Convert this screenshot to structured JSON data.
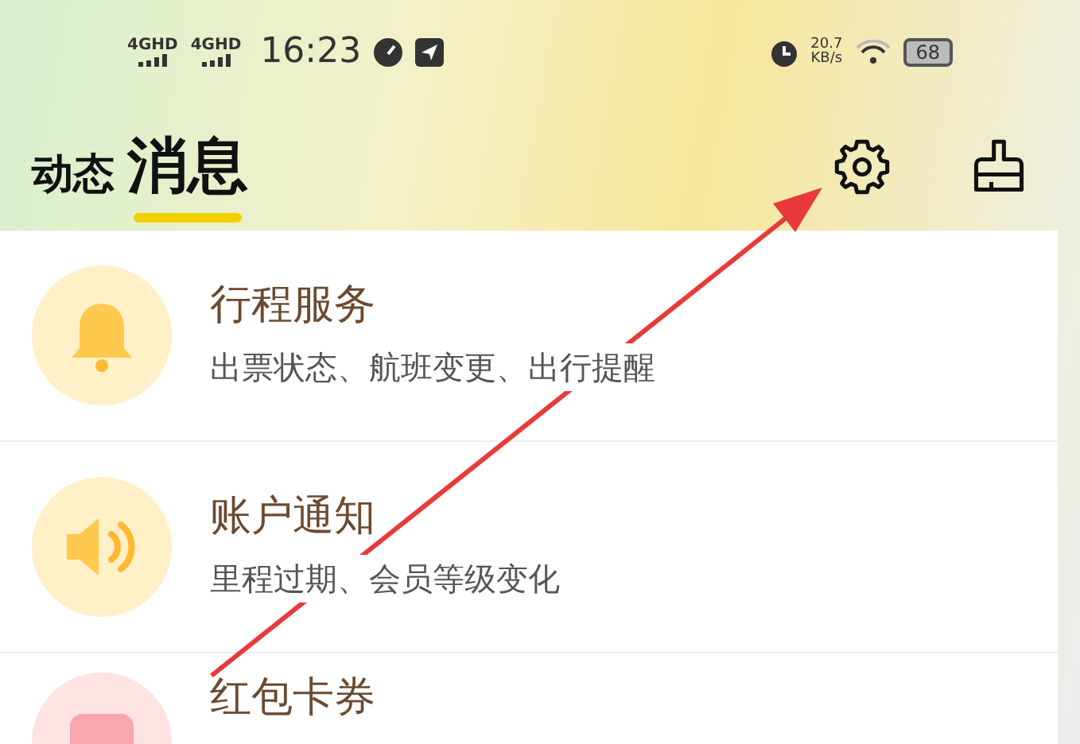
{
  "status_bar": {
    "signals": [
      "4GHD",
      "4GHD"
    ],
    "time": "16:23",
    "speed_value": "20.7",
    "speed_unit": "KB/s",
    "battery": "68"
  },
  "tabs": [
    {
      "label": "动态",
      "selected": false
    },
    {
      "label": "消息",
      "selected": true
    }
  ],
  "items": [
    {
      "kind": "bell",
      "title": "行程服务",
      "subtitle": "出票状态、航班变更、出行提醒"
    },
    {
      "kind": "speaker",
      "title": "账户通知",
      "subtitle": "里程过期、会员等级变化"
    },
    {
      "kind": "coupon",
      "title": "红包卡券"
    }
  ]
}
